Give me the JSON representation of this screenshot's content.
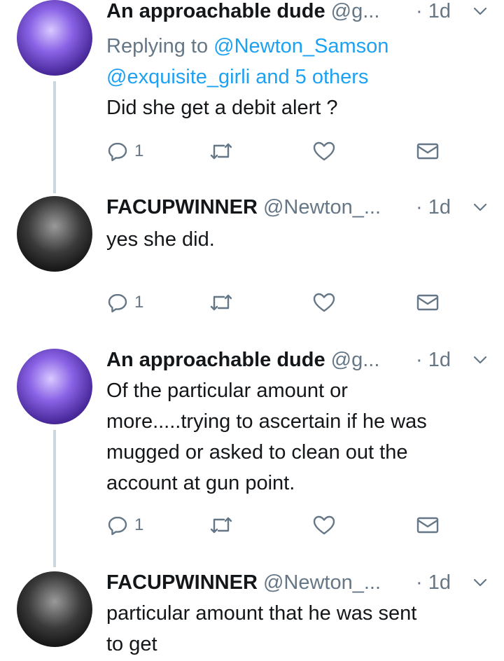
{
  "tweets": [
    {
      "name": "An approachable dude",
      "handle": "@g...",
      "time": "· 1d",
      "reply_prefix": "Replying to",
      "reply_line1": "@Newton_Samson",
      "reply_line2": "@exquisite_girli and 5 others",
      "text": "Did she get a debit alert ?",
      "reply_count": "1"
    },
    {
      "name": "FACUPWINNER",
      "handle": "@Newton_...",
      "time": "· 1d",
      "text": "yes she did.",
      "reply_count": "1"
    },
    {
      "name": "An approachable dude",
      "handle": "@g...",
      "time": "· 1d",
      "text_lines": [
        "Of the particular amount or",
        "more.....trying to ascertain if he was",
        "mugged or asked to clean out the",
        "account at gun point."
      ],
      "reply_count": "1"
    },
    {
      "name": "FACUPWINNER",
      "handle": "@Newton_...",
      "time": "· 1d",
      "text_lines": [
        "particular amount that he  was sent",
        "to get"
      ]
    }
  ],
  "colors": {
    "text": "#14171a",
    "secondary": "#657786",
    "link": "#1da1f2",
    "thread_line": "#ccd6dd"
  },
  "icons": [
    "reply-icon",
    "retweet-icon",
    "like-icon",
    "dm-icon",
    "chevron-down-icon"
  ]
}
